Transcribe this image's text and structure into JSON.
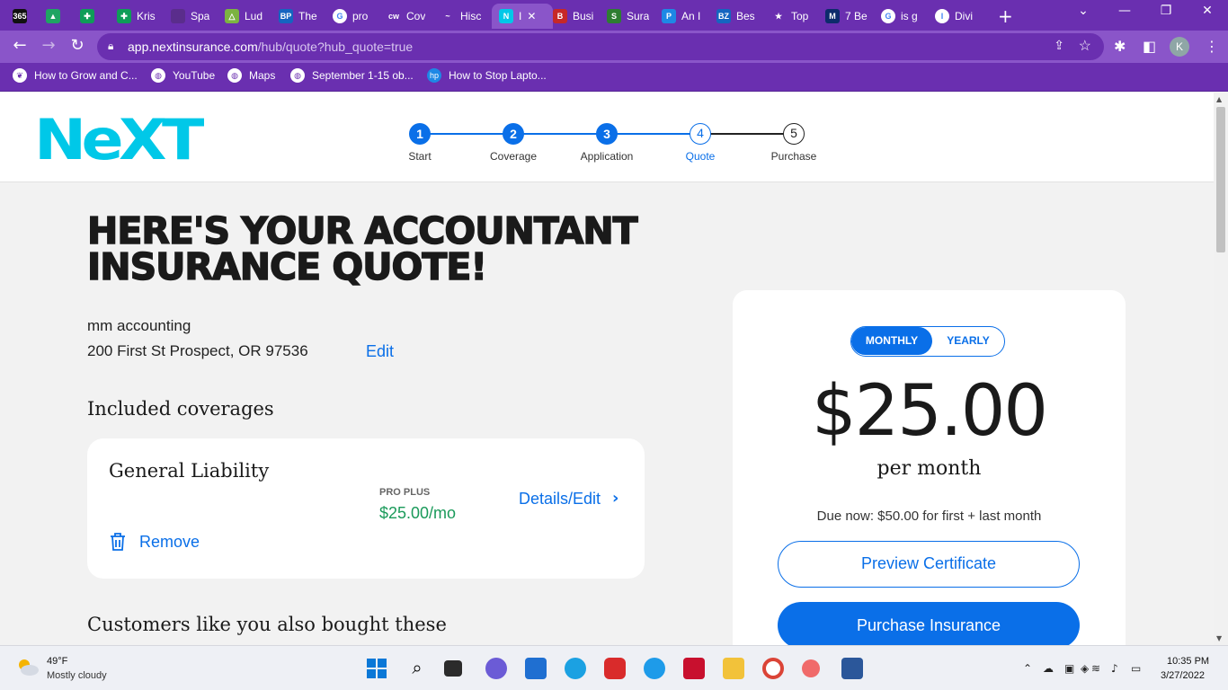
{
  "browser": {
    "tabs": [
      {
        "label": "",
        "icon": "office365-icon",
        "color": "#111111",
        "fav": "365"
      },
      {
        "label": "",
        "icon": "google-drive-icon",
        "color": "#1fa463",
        "fav": "▲"
      },
      {
        "label": "",
        "icon": "sheets-icon",
        "color": "#0f9d58",
        "fav": "✚"
      },
      {
        "label": "Kris",
        "icon": "sheets-icon",
        "color": "#0f9d58",
        "fav": "✚"
      },
      {
        "label": "Spa",
        "icon": "generic-tab-icon",
        "color": "#5a2d8c",
        "fav": ""
      },
      {
        "label": "Lud",
        "icon": "alpha-icon",
        "color": "#7cb342",
        "fav": "△"
      },
      {
        "label": "The",
        "icon": "bp-icon",
        "color": "#1565c0",
        "fav": "BP"
      },
      {
        "label": "pro",
        "icon": "google-icon",
        "color": "#ffffff",
        "fav": "G"
      },
      {
        "label": "Cov",
        "icon": "cw-icon",
        "color": "#6a2fb0",
        "fav": "cw"
      },
      {
        "label": "Hisc",
        "icon": "hiscox-icon",
        "color": "#6a2fb0",
        "fav": "~"
      },
      {
        "label": "I",
        "icon": "next-n-icon",
        "color": "#00c8e8",
        "fav": "N"
      },
      {
        "label": "Busi",
        "icon": "business-icon",
        "color": "#c62828",
        "fav": "B"
      },
      {
        "label": "Sura",
        "icon": "surance-icon",
        "color": "#2e7d32",
        "fav": "S"
      },
      {
        "label": "An I",
        "icon": "paypal-icon",
        "color": "#1e88e5",
        "fav": "P"
      },
      {
        "label": "Bes",
        "icon": "bz-icon",
        "color": "#1565c0",
        "fav": "BZ"
      },
      {
        "label": "Top",
        "icon": "walker-icon",
        "color": "#6a2fb0",
        "fav": "★"
      },
      {
        "label": "7 Be",
        "icon": "m-icon",
        "color": "#0d2b6b",
        "fav": "M"
      },
      {
        "label": "is g",
        "icon": "google-icon",
        "color": "#ffffff",
        "fav": "G"
      },
      {
        "label": "Divi",
        "icon": "divi-icon",
        "color": "#ffffff",
        "fav": "I"
      }
    ],
    "url_host": "app.nextinsurance.com",
    "url_path": "/hub/quote?hub_quote=true",
    "profile_initial": "K",
    "bookmarks": [
      {
        "label": "How to Grow and C...",
        "icon": "bird-icon"
      },
      {
        "label": "YouTube",
        "icon": "globe-icon"
      },
      {
        "label": "Maps",
        "icon": "globe-icon"
      },
      {
        "label": "September 1-15 ob...",
        "icon": "globe-icon"
      },
      {
        "label": "How to Stop Lapto...",
        "icon": "hp-icon"
      }
    ]
  },
  "site": {
    "logo_text": "NeXT",
    "steps": [
      {
        "number": "1",
        "label": "Start",
        "state": "done"
      },
      {
        "number": "2",
        "label": "Coverage",
        "state": "done"
      },
      {
        "number": "3",
        "label": "Application",
        "state": "done"
      },
      {
        "number": "4",
        "label": "Quote",
        "state": "current"
      },
      {
        "number": "5",
        "label": "Purchase",
        "state": "future"
      }
    ]
  },
  "quote": {
    "headline_line1": "HERE'S YOUR ACCOUNTANT",
    "headline_line2": "INSURANCE QUOTE!",
    "business_name": "mm accounting",
    "address": "200 First St Prospect, OR 97536",
    "edit_label": "Edit",
    "included_title": "Included coverages",
    "coverage": {
      "name": "General Liability",
      "tier": "PRO PLUS",
      "price": "$25.00/mo",
      "details_label": "Details/Edit",
      "remove_label": "Remove"
    },
    "also_bought_title": "Customers like you also bought these"
  },
  "pricing": {
    "monthly_label": "MONTHLY",
    "yearly_label": "YEARLY",
    "selected": "monthly",
    "amount": "$25.00",
    "period": "per month",
    "due_now": "Due now: $50.00 for first + last month",
    "preview_label": "Preview Certificate",
    "purchase_label": "Purchase Insurance",
    "accent_color": "#0a6fe8"
  },
  "taskbar": {
    "temperature": "49°F",
    "weather": "Mostly cloudy",
    "time": "10:35 PM",
    "date": "3/27/2022"
  }
}
